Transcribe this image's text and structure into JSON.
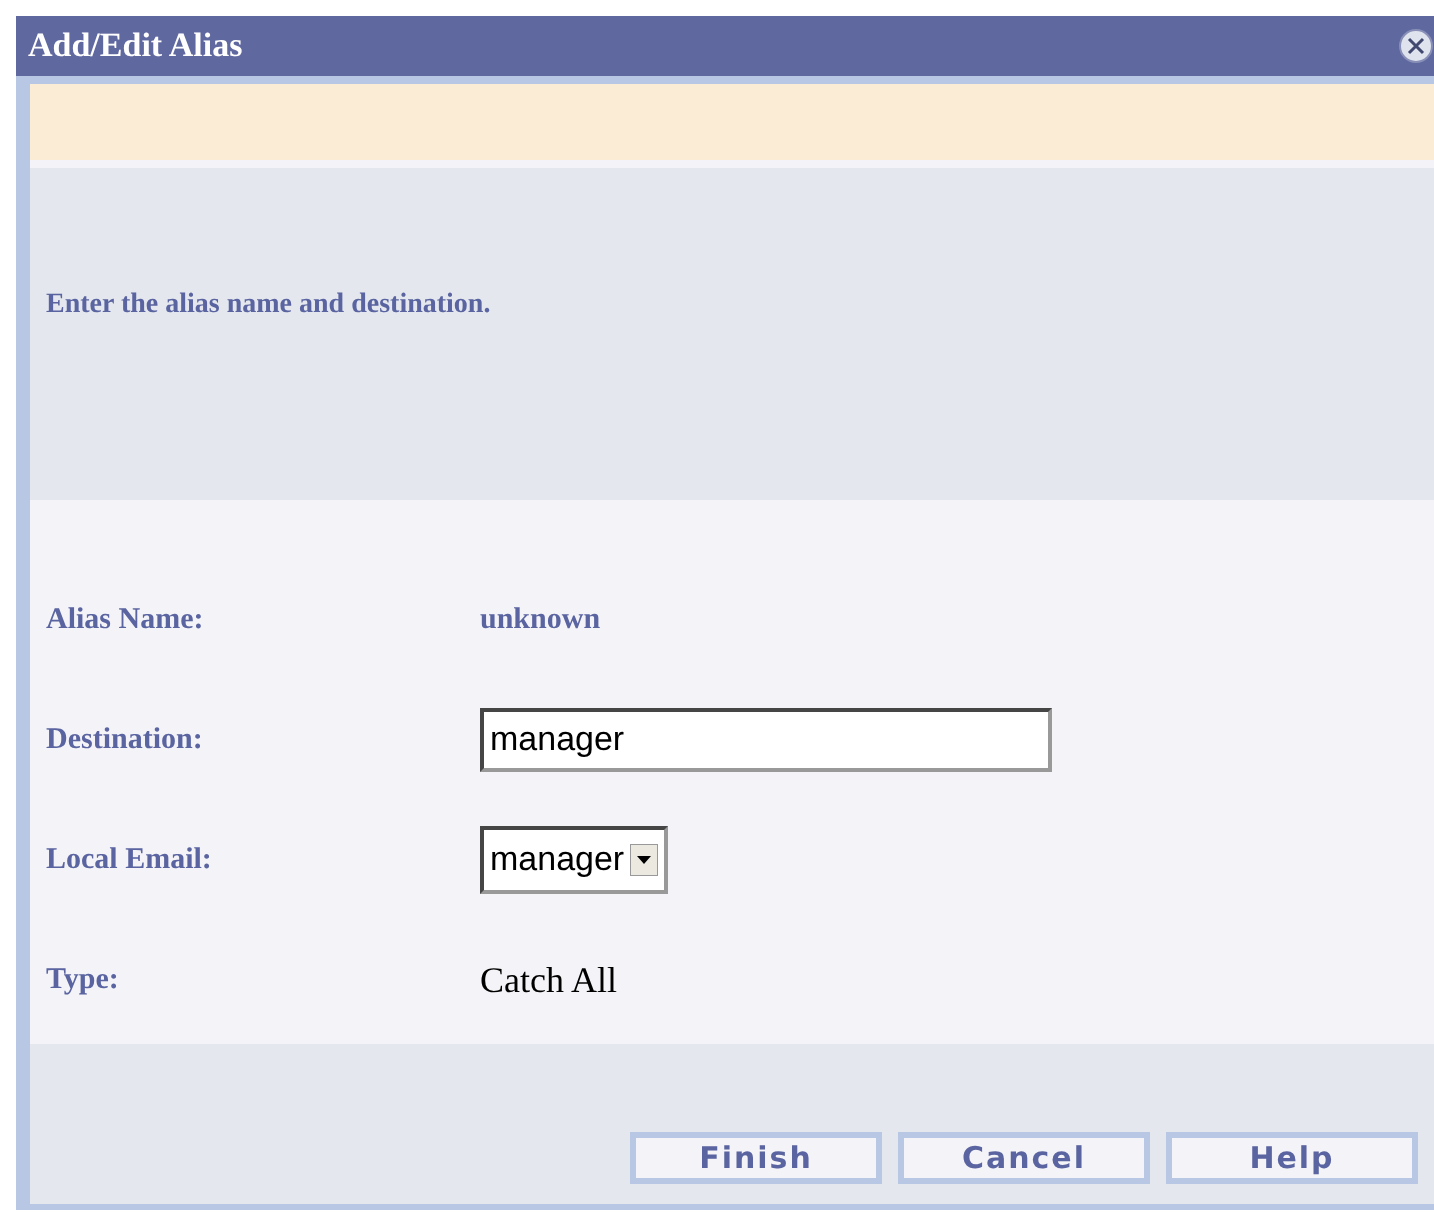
{
  "window": {
    "title": "Add/Edit Alias"
  },
  "instruction": "Enter the alias name and destination.",
  "fields": [
    {
      "kind": "static",
      "label": "Alias Name:",
      "value": "unknown"
    },
    {
      "kind": "text",
      "label": "Destination:",
      "value": "manager"
    },
    {
      "kind": "select",
      "label": "Local Email:",
      "value": "manager"
    },
    {
      "kind": "plain",
      "label": "Type:",
      "value": "Catch All"
    }
  ],
  "buttons": [
    "Finish",
    "Cancel",
    "Help"
  ]
}
